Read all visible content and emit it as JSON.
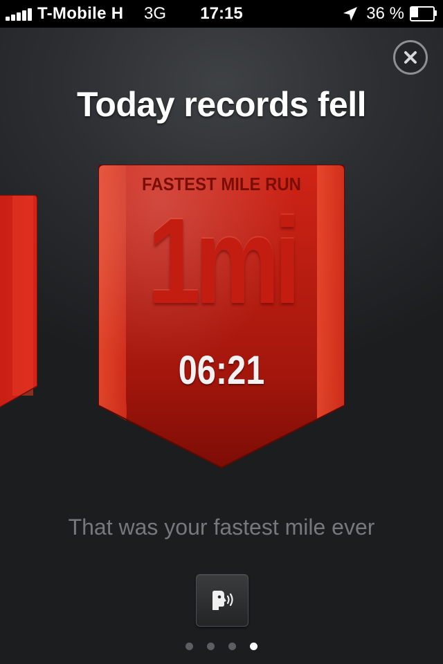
{
  "status_bar": {
    "carrier": "T-Mobile H",
    "network": "3G",
    "time": "17:15",
    "battery_percent_label": "36 %",
    "battery_level": 0.36,
    "signal_bars": 5,
    "icons": [
      "signal-bars-icon",
      "location-arrow-icon",
      "battery-icon"
    ]
  },
  "screen": {
    "title": "Today records fell",
    "close_icon": "close-icon",
    "record": {
      "category": "FASTEST MILE RUN",
      "distance": "1mi",
      "time": "06:21",
      "accent_color": "#d9261a"
    },
    "caption": "That was your fastest mile ever",
    "voice_icon": "speaking-head-icon",
    "pager": {
      "total": 4,
      "active_index": 3
    }
  },
  "colors": {
    "background": "#1c1d1f",
    "badge_red": "#d9261a",
    "badge_dark_red": "#9b120a",
    "caption_gray": "#76787b"
  }
}
